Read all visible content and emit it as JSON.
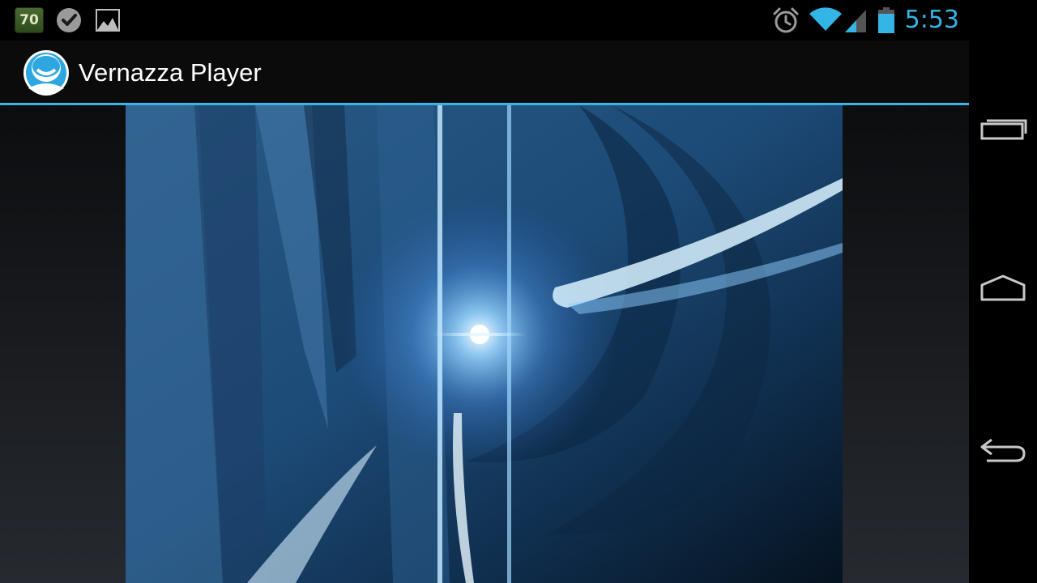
{
  "status_bar": {
    "notification_badge": "70",
    "notification_icons": [
      "counter-badge-icon",
      "checkmark-bubble-icon",
      "gallery-image-icon"
    ],
    "system_icons": [
      "alarm-clock-icon",
      "wifi-icon",
      "cell-signal-icon",
      "battery-icon"
    ],
    "time": "5:53",
    "accent_color": "#33b5e5"
  },
  "action_bar": {
    "app_icon": "vernazza-face-icon",
    "title": "Vernazza Player",
    "divider_color": "#33b5e5"
  },
  "content": {
    "video_frame": "abstract-blue-light-video-frame"
  },
  "nav_bar": {
    "buttons": [
      "recent-apps-icon",
      "home-icon",
      "back-icon"
    ]
  }
}
